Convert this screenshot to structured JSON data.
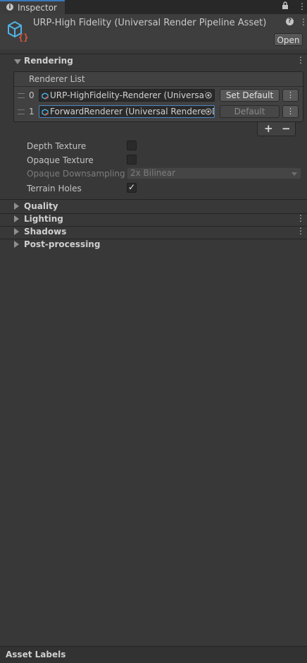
{
  "tab": {
    "label": "Inspector"
  },
  "header": {
    "title": "URP-High Fidelity (Universal Render Pipeline Asset)",
    "open_label": "Open"
  },
  "sections": {
    "rendering": "Rendering",
    "quality": "Quality",
    "lighting": "Lighting",
    "shadows": "Shadows",
    "postprocessing": "Post-processing"
  },
  "renderer_list": {
    "title": "Renderer List",
    "rows": [
      {
        "index": "0",
        "value": "URP-HighFidelity-Renderer (Universal",
        "button": "Set Default"
      },
      {
        "index": "1",
        "value": "ForwardRenderer (Universal Renderer D",
        "button": "Default"
      }
    ],
    "add_label": "+",
    "remove_label": "−"
  },
  "properties": {
    "depth_texture": {
      "label": "Depth Texture",
      "checked": false
    },
    "opaque_texture": {
      "label": "Opaque Texture",
      "checked": false
    },
    "opaque_downsampling": {
      "label": "Opaque Downsampling",
      "value": "2x Bilinear"
    },
    "terrain_holes": {
      "label": "Terrain Holes",
      "checked": true
    }
  },
  "footer": {
    "asset_labels": "Asset Labels"
  },
  "colors": {
    "accent": "#3a79bb",
    "background": "#383838",
    "header": "#3e3e3e"
  }
}
